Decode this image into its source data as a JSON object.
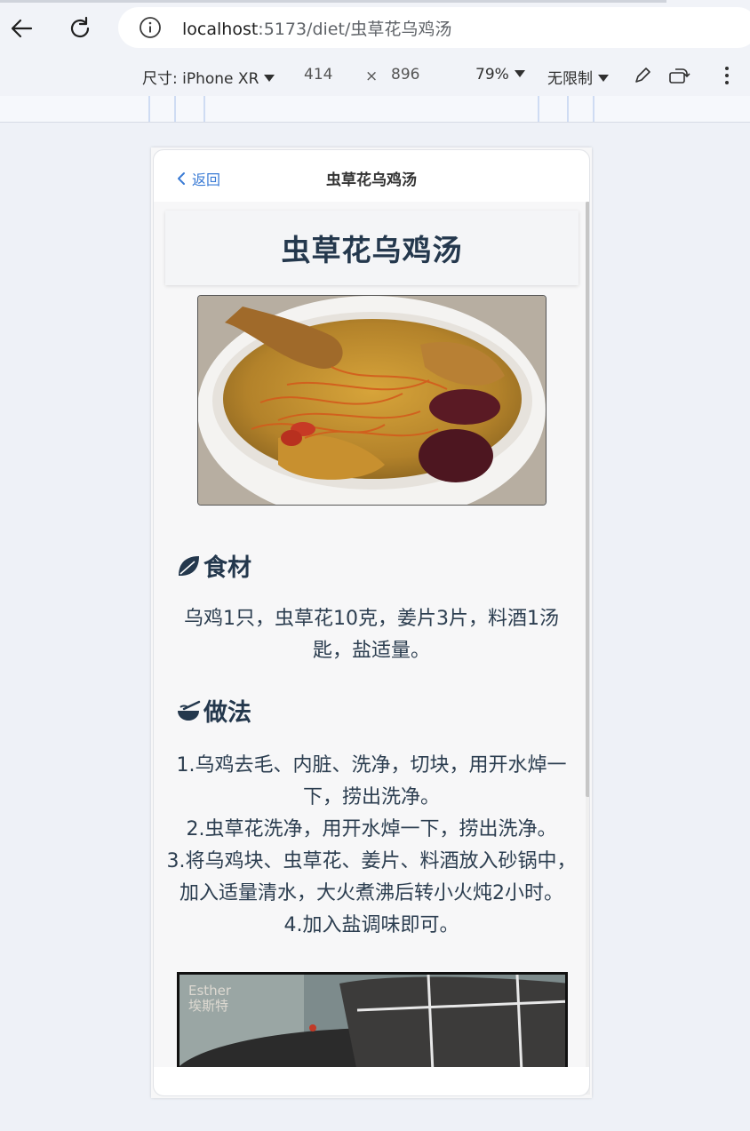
{
  "browser": {
    "url_host": "localhost",
    "url_path": ":5173/diet/虫草花乌鸡汤",
    "icons": {
      "back": "arrow-left-icon",
      "reload": "reload-icon",
      "info": "info-icon"
    }
  },
  "devtools": {
    "device_label": "尺寸: iPhone XR",
    "width": "414",
    "times": "×",
    "height": "896",
    "zoom": "79%",
    "throttle": "无限制",
    "icons": [
      "pen-icon",
      "rotate-icon",
      "more-vert-icon"
    ]
  },
  "app": {
    "back_label": "返回",
    "header_title": "虫草花乌鸡汤",
    "page_title": "虫草花乌鸡汤",
    "ingredients_heading": "食材",
    "ingredients_text": "乌鸡1只，虫草花10克，姜片3片，料酒1汤匙，盐适量。",
    "method_heading": "做法",
    "steps": [
      "1.乌鸡去毛、内脏、洗净，切块，用开水焯一下，捞出洗净。",
      "2.虫草花洗净，用开水焯一下，捞出洗净。",
      "3.将乌鸡块、虫草花、姜片、料酒放入砂锅中，加入适量清水，大火煮沸后转小火炖2小时。",
      "4.加入盐调味即可。"
    ],
    "video_watermark_line1": "Esther",
    "video_watermark_line2": "埃斯特"
  },
  "colors": {
    "accent": "#3a7bd5",
    "heading": "#24384d",
    "page_bg": "#eef1f7"
  }
}
